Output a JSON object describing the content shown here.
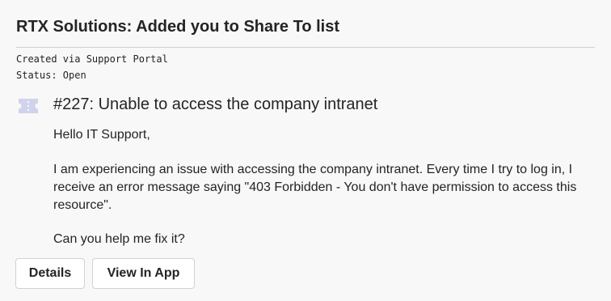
{
  "card": {
    "title": "RTX Solutions: Added you to Share To list",
    "created": "Created via Support Portal",
    "status": "Status: Open"
  },
  "ticket": {
    "icon": "ticket-icon",
    "title": "#227: Unable to access the company intranet",
    "greeting": "Hello IT Support,",
    "message": "I am experiencing an issue with accessing the company intranet. Every time I try to log in, I receive an error message saying \"403 Forbidden - You don't have permission to access this resource\".",
    "question": "Can you help me fix it?"
  },
  "actions": {
    "details_label": "Details",
    "view_in_app_label": "View In App"
  },
  "colors": {
    "background": "#f8f8f8",
    "text": "#242424",
    "icon": "#c5cae9",
    "border": "#d1d1d1"
  }
}
